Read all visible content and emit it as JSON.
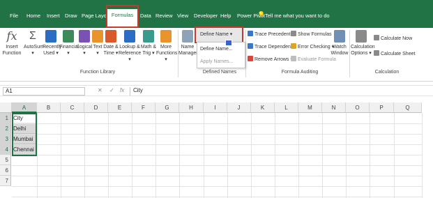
{
  "tabs": [
    "File",
    "Home",
    "Insert",
    "Draw",
    "Page Layout",
    "Formulas",
    "Data",
    "Review",
    "View",
    "Developer",
    "Help",
    "Power Pivot"
  ],
  "active_tab": "Formulas",
  "tell_me": "Tell me what you want to do",
  "ribbon": {
    "insert_function": [
      "Insert",
      "Function"
    ],
    "autosum": [
      "AutoSum",
      "▾"
    ],
    "recently_used": [
      "Recently",
      "Used ▾"
    ],
    "financial": [
      "Financial",
      "▾"
    ],
    "logical": [
      "Logical",
      "▾"
    ],
    "text": [
      "Text",
      "▾"
    ],
    "date_time": [
      "Date &",
      "Time ▾"
    ],
    "lookup_ref": [
      "Lookup &",
      "Reference ▾"
    ],
    "math_trig": [
      "Math &",
      "Trig ▾"
    ],
    "more_functions": [
      "More",
      "Functions ▾"
    ],
    "function_library_label": "Function Library",
    "name_manager": [
      "Name",
      "Manager"
    ],
    "define_name": "Define Name ▾",
    "define_name_menu": [
      "Define Name...",
      "Apply Names..."
    ],
    "defined_names_label": "Defined Names",
    "trace_precedents": "Trace Precedents",
    "trace_dependents": "Trace Dependents",
    "remove_arrows": "Remove Arrows ▾",
    "show_formulas": "Show Formulas",
    "error_checking": "Error Checking ▾",
    "evaluate_formula": "Evaluate Formula",
    "formula_auditing_label": "Formula Auditing",
    "watch_window": [
      "Watch",
      "Window"
    ],
    "calc_options": [
      "Calculation",
      "Options ▾"
    ],
    "calculate_now": "Calculate Now",
    "calculate_sheet": "Calculate Sheet",
    "calculation_label": "Calculation"
  },
  "formula_bar": {
    "name_box": "A1",
    "cancel": "✕",
    "enter": "✓",
    "fx": "fx",
    "content": "City"
  },
  "columns": [
    "A",
    "B",
    "C",
    "D",
    "E",
    "F",
    "G",
    "H",
    "I",
    "J",
    "K",
    "L",
    "M",
    "N",
    "O",
    "P",
    "Q"
  ],
  "rows": [
    "1",
    "2",
    "3",
    "4",
    "5",
    "6",
    "7"
  ],
  "cells": [
    "City",
    "Delhi",
    "Mumbai",
    "Chennai"
  ],
  "colors": {
    "accent": "#217346",
    "highlight": "#c8382b"
  }
}
